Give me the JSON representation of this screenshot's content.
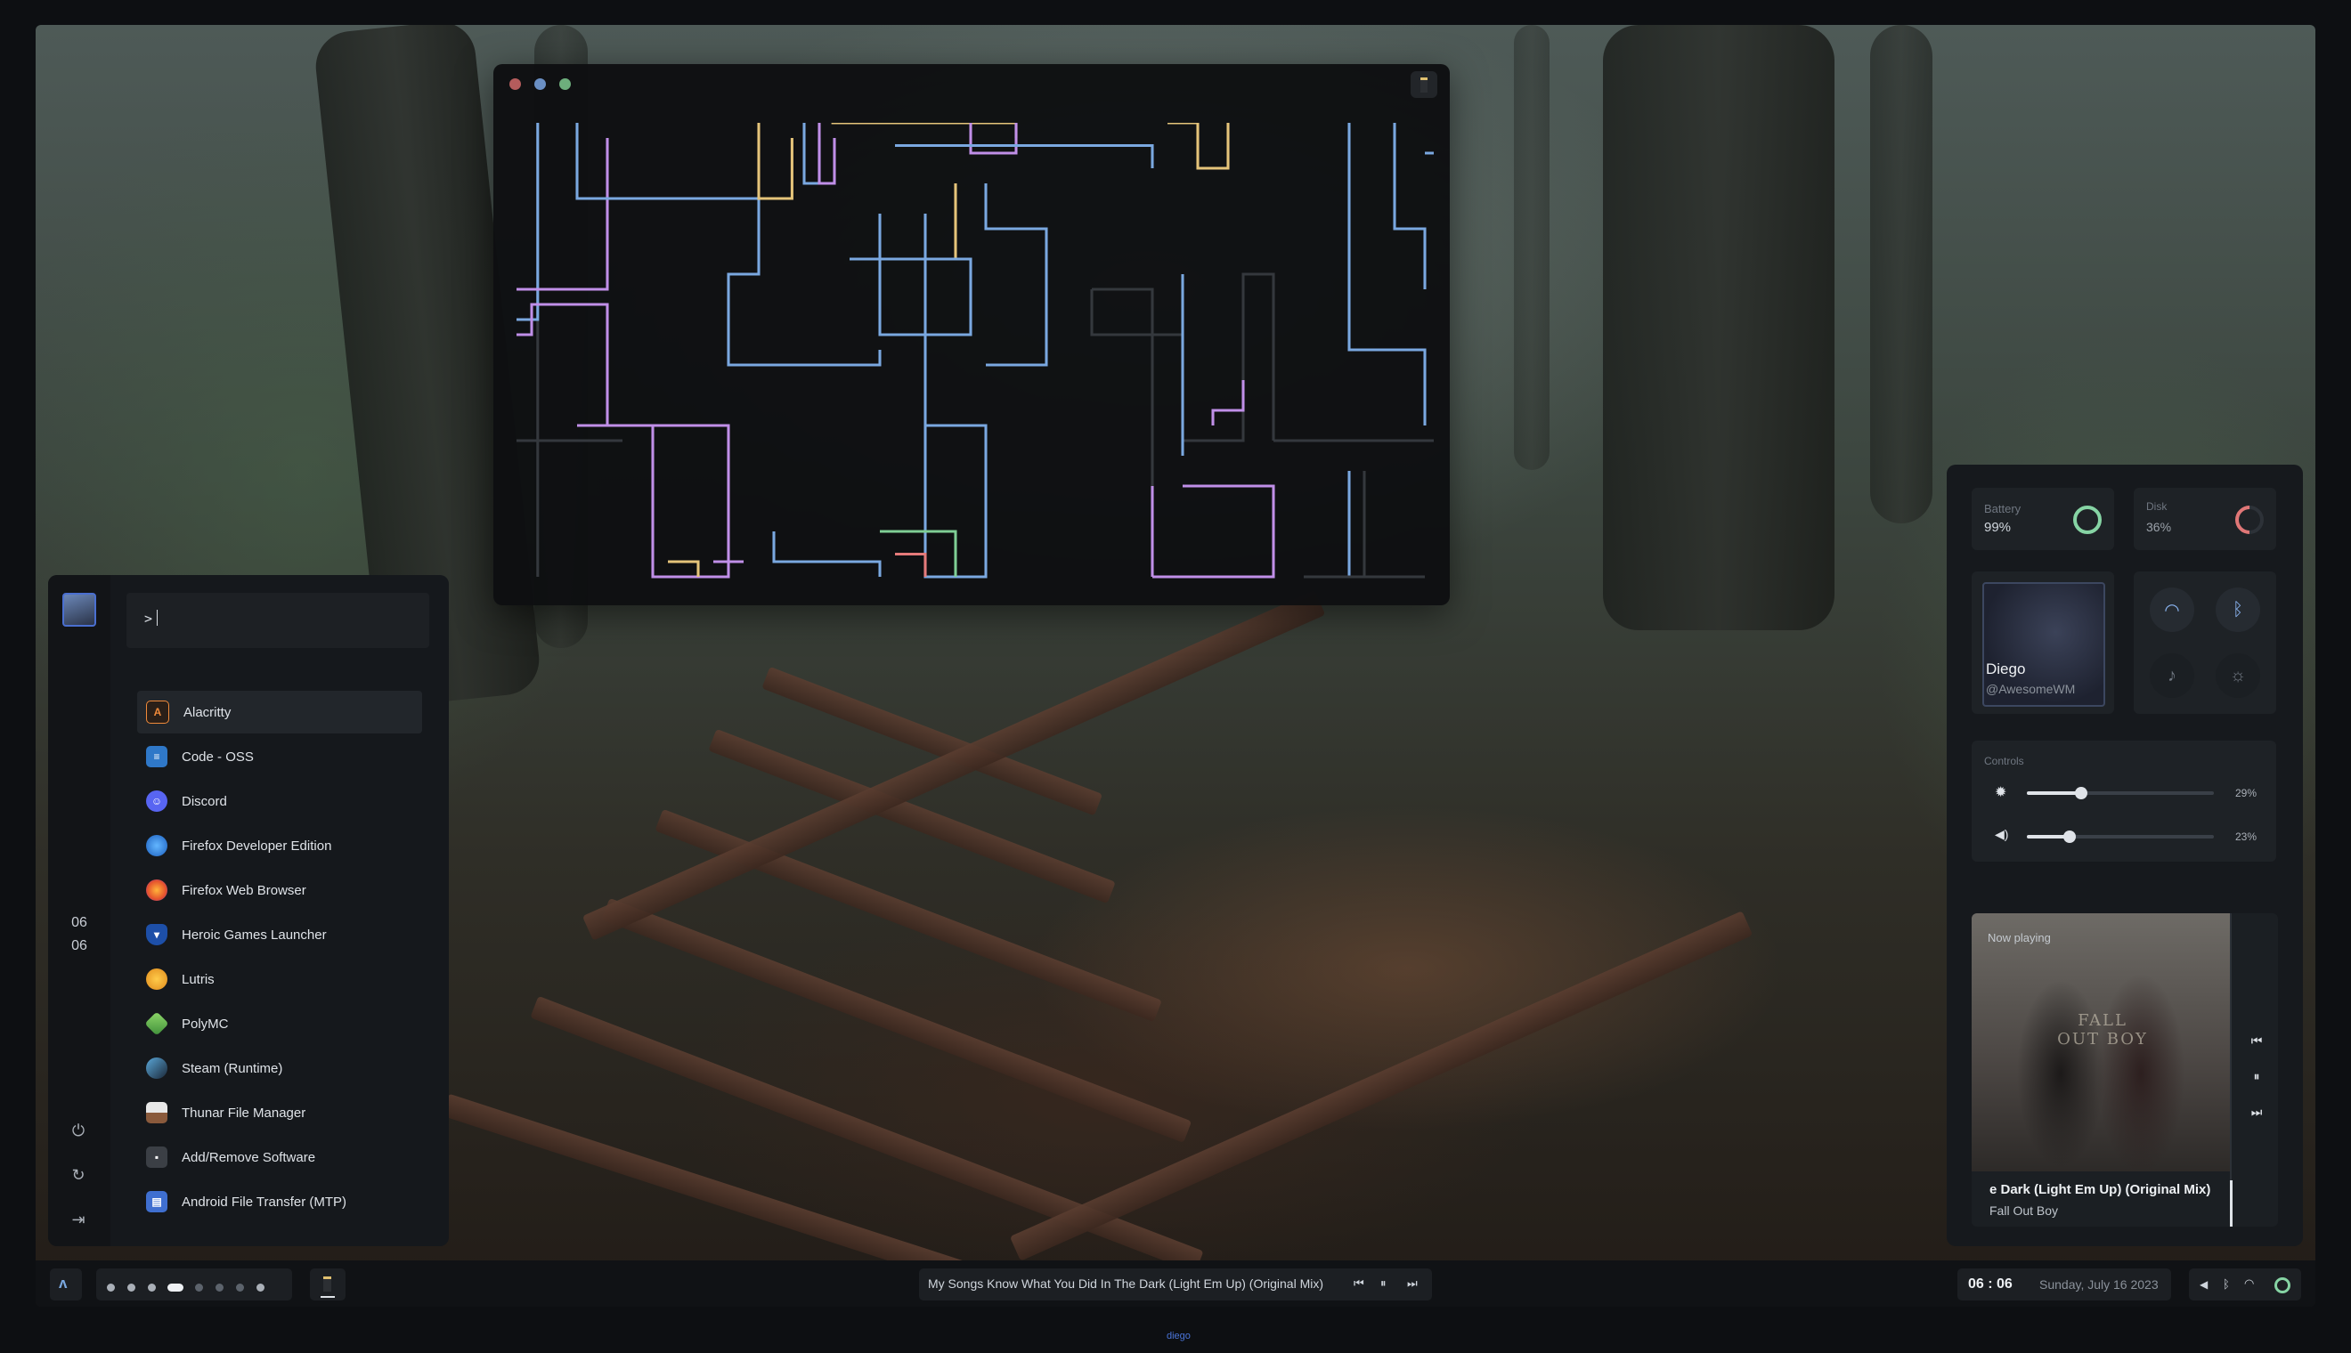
{
  "colors": {
    "accent_blue": "#7aa8e0",
    "pipe_purple": "#c08fe8",
    "pipe_yellow": "#e5c47a",
    "pipe_green": "#7fce95",
    "pipe_red": "#e57a7a",
    "pipe_dim": "#34383d",
    "battery_ring": "#86d4a4",
    "disk_ring": "#e07777"
  },
  "launcher": {
    "prompt": ">",
    "clock": {
      "hour": "06",
      "minute": "06"
    },
    "apps": [
      {
        "label": "Alacritty",
        "icon": "alacritty-icon"
      },
      {
        "label": "Code - OSS",
        "icon": "code-oss-icon"
      },
      {
        "label": "Discord",
        "icon": "discord-icon"
      },
      {
        "label": "Firefox Developer Edition",
        "icon": "firefox-dev-icon"
      },
      {
        "label": "Firefox Web Browser",
        "icon": "firefox-icon"
      },
      {
        "label": "Heroic Games Launcher",
        "icon": "heroic-icon"
      },
      {
        "label": "Lutris",
        "icon": "lutris-icon"
      },
      {
        "label": "PolyMC",
        "icon": "polymc-icon"
      },
      {
        "label": "Steam (Runtime)",
        "icon": "steam-icon"
      },
      {
        "label": "Thunar File Manager",
        "icon": "thunar-icon"
      },
      {
        "label": "Add/Remove Software",
        "icon": "software-icon"
      },
      {
        "label": "Android File Transfer (MTP)",
        "icon": "android-mtp-icon"
      }
    ]
  },
  "dashboard": {
    "battery": {
      "label": "Battery",
      "value": "99%"
    },
    "disk": {
      "label": "Disk",
      "value": "36%"
    },
    "profile": {
      "name": "Diego",
      "handle": "@AwesomeWM"
    },
    "controls": {
      "label": "Controls",
      "brightness": {
        "value": "29%",
        "level": 0.29
      },
      "volume": {
        "value": "23%",
        "level": 0.23
      }
    },
    "media": {
      "label": "Now playing",
      "title": "e Dark (Light Em Up) (Original Mix)",
      "artist": "Fall Out Boy",
      "art_text": "FALL OUT BOY"
    }
  },
  "bar": {
    "now_playing": "My Songs Know What You Did In The Dark (Light Em Up) (Original Mix)",
    "time": "06 : 06",
    "date": "Sunday, July 16 2023"
  },
  "bottom_label": "diego"
}
